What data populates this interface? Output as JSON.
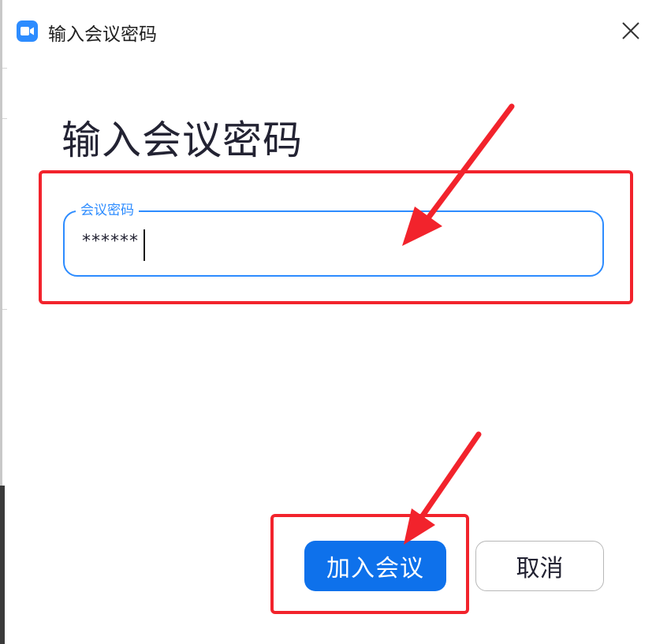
{
  "window": {
    "title": "输入会议密码",
    "app_icon": "zoom-camera-icon",
    "close_icon": "close-icon"
  },
  "dialog": {
    "heading": "输入会议密码",
    "password_field": {
      "label": "会议密码",
      "value": "******"
    },
    "join_button_label": "加入会议",
    "cancel_button_label": "取消"
  },
  "annotations": {
    "color": "#f2232c",
    "items": [
      "arrow",
      "box"
    ]
  },
  "colors": {
    "accent": "#2d8cff",
    "primary_button": "#0e71eb",
    "annotation": "#f2232c"
  }
}
